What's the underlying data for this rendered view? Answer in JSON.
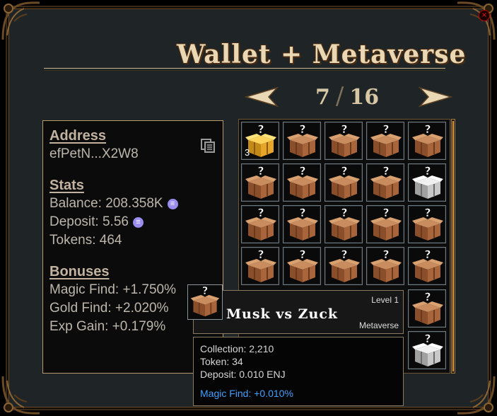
{
  "window": {
    "title": "Wallet + Metaverse",
    "close_icon": "close-icon"
  },
  "pager": {
    "current": "7",
    "separator": "/",
    "total": "16"
  },
  "account": {
    "address_label": "Address",
    "address_value": "efPetN...X2W8",
    "stats_label": "Stats",
    "balance": "Balance: 208.358K",
    "deposit": "Deposit: 5.56",
    "tokens": "Tokens: 464",
    "bonuses_label": "Bonuses",
    "magic_find": "Magic Find: +1.750%",
    "gold_find": "Gold Find: +2.020%",
    "exp_gain": "Exp Gain: +0.179%"
  },
  "grid": {
    "slots": [
      {
        "kind": "gold",
        "count": "3"
      },
      {
        "kind": "brown"
      },
      {
        "kind": "brown"
      },
      {
        "kind": "brown"
      },
      {
        "kind": "brown"
      },
      {
        "kind": "brown"
      },
      {
        "kind": "brown"
      },
      {
        "kind": "brown"
      },
      {
        "kind": "brown"
      },
      {
        "kind": "white"
      },
      {
        "kind": "brown"
      },
      {
        "kind": "brown"
      },
      {
        "kind": "brown"
      },
      {
        "kind": "brown"
      },
      {
        "kind": "brown"
      },
      {
        "kind": "brown"
      },
      {
        "kind": "brown"
      },
      {
        "kind": "brown"
      },
      {
        "kind": "brown"
      },
      {
        "kind": "brown"
      },
      {
        "kind": "brown"
      },
      {
        "kind": "white"
      }
    ]
  },
  "tooltip": {
    "name": "Musk vs Zuck",
    "level": "Level 1",
    "collection_name": "Metaverse",
    "collection": "Collection: 2,210",
    "token": "Token: 34",
    "deposit": "Deposit: 0.010 ENJ",
    "magic_find": "Magic Find: +0.010%"
  },
  "colors": {
    "gold": "#d4a13a",
    "magic": "#3ea0ff",
    "frame": "#1f2526"
  }
}
